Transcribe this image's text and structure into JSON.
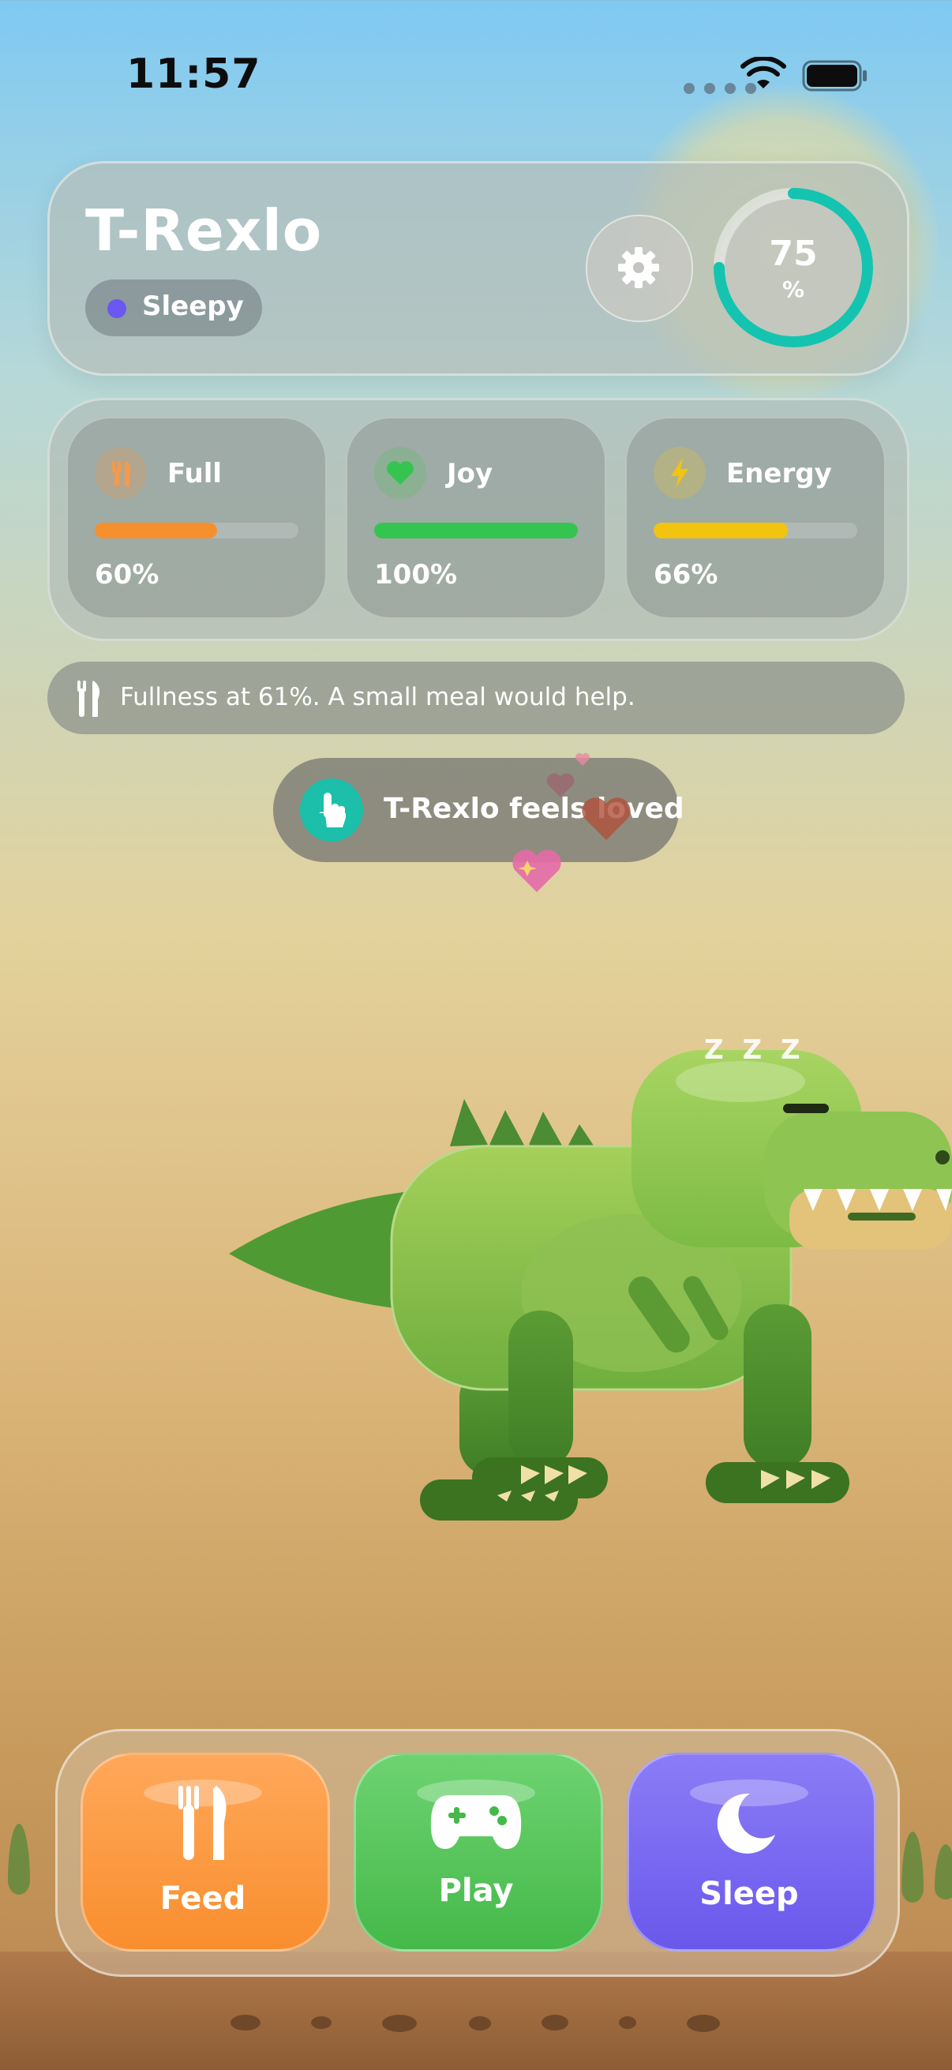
{
  "status_bar": {
    "time": "11:57"
  },
  "header": {
    "pet_name": "T-Rexlo",
    "mood": "Sleepy",
    "mood_color": "#6a58f0",
    "overall": {
      "value": "75",
      "unit": "%",
      "progress": 0.75,
      "color": "#14c4b0"
    }
  },
  "stats": [
    {
      "label": "Full",
      "value_text": "60%",
      "level": 0.6,
      "color": "#f5902e",
      "icon": "fork-knife-icon"
    },
    {
      "label": "Joy",
      "value_text": "100%",
      "level": 1.0,
      "color": "#35c44f",
      "icon": "heart-icon"
    },
    {
      "label": "Energy",
      "value_text": "66%",
      "level": 0.66,
      "color": "#f2c40f",
      "icon": "lightning-icon"
    }
  ],
  "hint": {
    "text": "Fullness at 61%. A small meal would help."
  },
  "toast": {
    "text": "T-Rexlo feels loved"
  },
  "sleep_indicator": "Z Z Z",
  "actions": {
    "feed": {
      "label": "Feed",
      "color": "#f98e2e"
    },
    "play": {
      "label": "Play",
      "color": "#45b94a"
    },
    "sleep": {
      "label": "Sleep",
      "color": "#6a58ec"
    }
  }
}
